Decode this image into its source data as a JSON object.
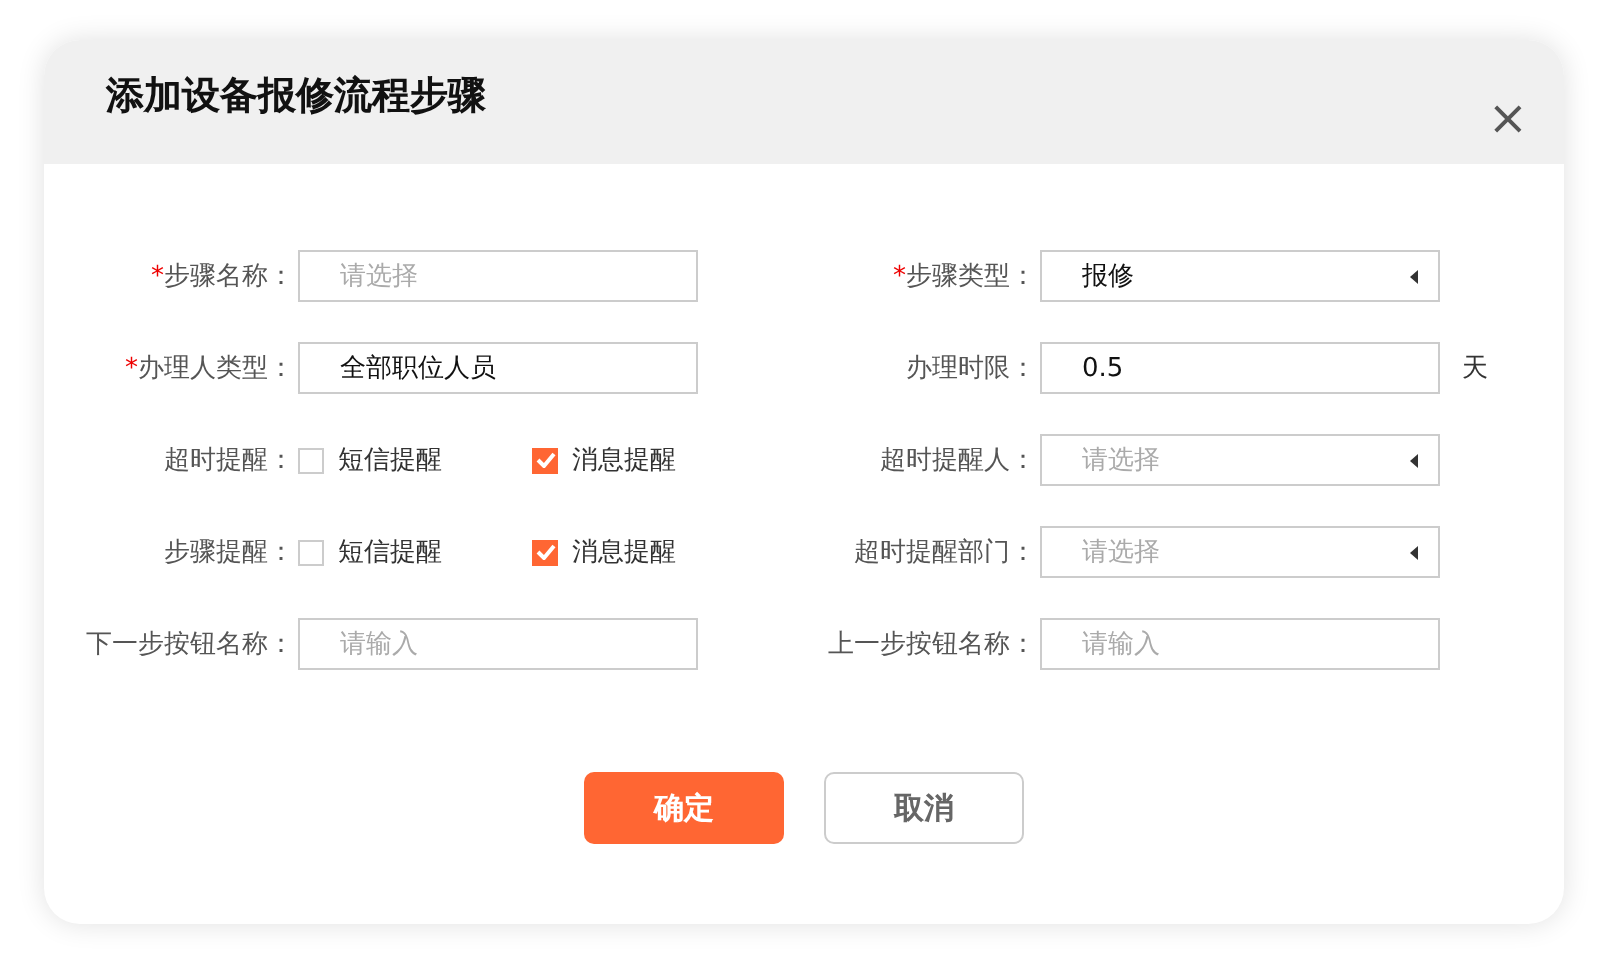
{
  "dialog": {
    "title": "添加设备报修流程步骤",
    "close": "×"
  },
  "rows": [
    [
      {
        "kind": "text",
        "mark": "*",
        "label": "步骤名称：",
        "placeholder": "请选择"
      },
      {
        "kind": "select",
        "mark": "*",
        "label": "步骤类型：",
        "value": "报修"
      }
    ],
    [
      {
        "kind": "text",
        "mark": "*",
        "label": "办理人类型：",
        "value": "全部职位人员"
      },
      {
        "kind": "text",
        "label": "办理时限：",
        "value": "0.5",
        "unit": "天"
      }
    ],
    [
      {
        "kind": "checks",
        "label": "超时提醒：",
        "options": [
          {
            "label": "短信提醒",
            "checked": false
          },
          {
            "label": "消息提醒",
            "checked": true
          }
        ]
      },
      {
        "kind": "select",
        "label": "超时提醒人：",
        "placeholder": "请选择"
      }
    ],
    [
      {
        "kind": "checks",
        "label": "步骤提醒：",
        "options": [
          {
            "label": "短信提醒",
            "checked": false
          },
          {
            "label": "消息提醒",
            "checked": true
          }
        ]
      },
      {
        "kind": "select",
        "label": "超时提醒部门：",
        "placeholder": "请选择"
      }
    ],
    [
      {
        "kind": "text",
        "label": "下一步按钮名称：",
        "placeholder": "请输入"
      },
      {
        "kind": "text",
        "label": "上一步按钮名称：",
        "placeholder": "请输入"
      }
    ]
  ],
  "buttons": [
    {
      "label": "确定",
      "kind": "primary"
    },
    {
      "label": "取消",
      "kind": "secondary"
    }
  ]
}
